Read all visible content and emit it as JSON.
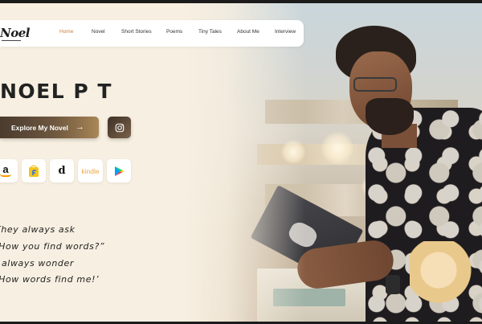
{
  "nav": {
    "logo": "Noel",
    "links": [
      {
        "label": "Home",
        "active": true
      },
      {
        "label": "Novel",
        "active": false
      },
      {
        "label": "Short Stories",
        "active": false
      },
      {
        "label": "Poems",
        "active": false
      },
      {
        "label": "Tiny Tales",
        "active": false
      },
      {
        "label": "About Me",
        "active": false
      },
      {
        "label": "Interview",
        "active": false
      }
    ]
  },
  "hero": {
    "title": "NOEL P T",
    "cta_label": "Explore My Novel",
    "cta_icon": "arrow-right-icon",
    "social_icon": "instagram-icon"
  },
  "stores": [
    {
      "name": "amazon",
      "icon": "amazon-icon",
      "text": "a"
    },
    {
      "name": "flipkart",
      "icon": "flipkart-icon"
    },
    {
      "name": "dailyhunt",
      "icon": "dailyhunt-icon",
      "text": "d"
    },
    {
      "name": "kindle",
      "icon": "kindle-icon",
      "text": "kindle"
    },
    {
      "name": "google-play",
      "icon": "google-play-icon"
    }
  ],
  "quote": {
    "lines": [
      "They always ask",
      "‘How you find words?”",
      "I always wonder",
      "‘How words find me!’"
    ]
  },
  "colors": {
    "background": "#f7efe1",
    "accent": "#c8803a",
    "button_dark": "#4a3b2d",
    "button_light": "#a88656"
  }
}
